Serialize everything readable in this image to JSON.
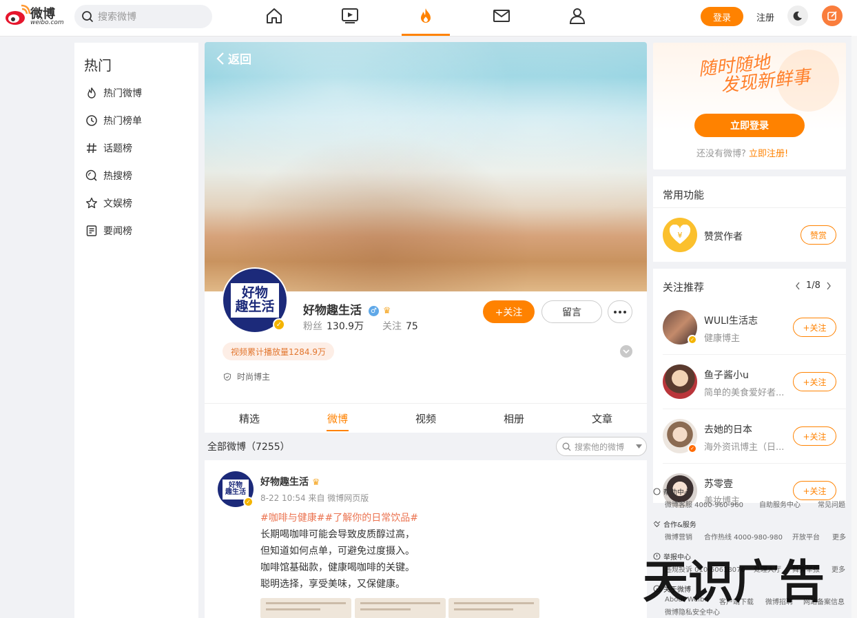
{
  "header": {
    "logo_text": "微博",
    "logo_sub": "weibo.com",
    "search_placeholder": "搜索微博",
    "login_label": "登录",
    "register_label": "注册",
    "accent_color": "#ff8200",
    "nav_icons": [
      "home-icon",
      "video-icon",
      "hot-icon",
      "mail-icon",
      "profile-icon"
    ]
  },
  "leftnav": {
    "title": "热门",
    "items": [
      {
        "label": "热门微博",
        "icon": "fire-icon"
      },
      {
        "label": "热门榜单",
        "icon": "clock-icon"
      },
      {
        "label": "话题榜",
        "icon": "hash-icon"
      },
      {
        "label": "热搜榜",
        "icon": "search-rank-icon"
      },
      {
        "label": "文娱榜",
        "icon": "star-icon"
      },
      {
        "label": "要闻榜",
        "icon": "news-icon"
      }
    ]
  },
  "profile": {
    "back_label": "返回",
    "avatar_text_1": "好物",
    "avatar_text_2": "趣生活",
    "nickname": "好物趣生活",
    "fans_label": "粉丝",
    "fans_value": "130.9万",
    "following_label": "关注",
    "following_value": "75",
    "follow_label": "+关注",
    "message_label": "留言",
    "play_badge": "视频累计播放量1284.9万",
    "tag": "时尚博主",
    "tabs": [
      "精选",
      "微博",
      "视频",
      "相册",
      "文章"
    ],
    "active_tab": "微博"
  },
  "feed": {
    "count_label": "全部微博（7255）",
    "search_placeholder": "搜索他的微博",
    "post": {
      "author": "好物趣生活",
      "meta": "8-22 10:54 来自 微博网页版",
      "tags": "#咖啡与健康##了解你的日常饮品#",
      "lines": [
        "长期喝咖啡可能会导致皮质醇过高，",
        "但知道如何点单，可避免过度摄入。",
        "咖啡馆基础款，健康喝咖啡的关键。",
        "聪明选择，享受美味，又保健康。"
      ]
    }
  },
  "right": {
    "slogan_1": "随时随地",
    "slogan_2": "发现新鲜事",
    "login_now": "立即登录",
    "no_account": "还没有微博?",
    "register_now": "立即注册!",
    "func_title": "常用功能",
    "tip_label": "赞赏作者",
    "tip_btn": "赞赏",
    "rec_title": "关注推荐",
    "rec_pager": "1/8",
    "recommendations": [
      {
        "name": "WULI生活志",
        "desc": "健康博主",
        "follow": "+关注",
        "badge_color": "#f4b400"
      },
      {
        "name": "鱼子酱小u",
        "desc": "简单的美食爱好者...",
        "follow": "+关注",
        "badge_color": ""
      },
      {
        "name": "去她的日本",
        "desc": "海外资讯博主（日...",
        "follow": "+关注",
        "badge_color": "#ff6a00"
      },
      {
        "name": "苏零壹",
        "desc": "美妆博主",
        "follow": "+关注",
        "badge_color": ""
      }
    ]
  },
  "footer": {
    "help_center": "帮助中心",
    "help_items": [
      "微博客服 4000-960-960",
      "自助服务中心",
      "常见问题"
    ],
    "coop": "合作&服务",
    "coop_items": [
      "微博营销",
      "合作热线 4000-980-980",
      "开放平台",
      "更多"
    ],
    "report": "举报中心",
    "report_items": [
      "违规投诉 010-60618076",
      "处理大厅",
      "舞弊举报",
      "更多"
    ],
    "about": "关于微博",
    "about_items": [
      "About Weibo",
      "客户端下载",
      "微博招聘",
      "网站备案信息"
    ],
    "about_items_2": [
      "微博隐私安全中心"
    ],
    "watermark": "天识广告"
  }
}
